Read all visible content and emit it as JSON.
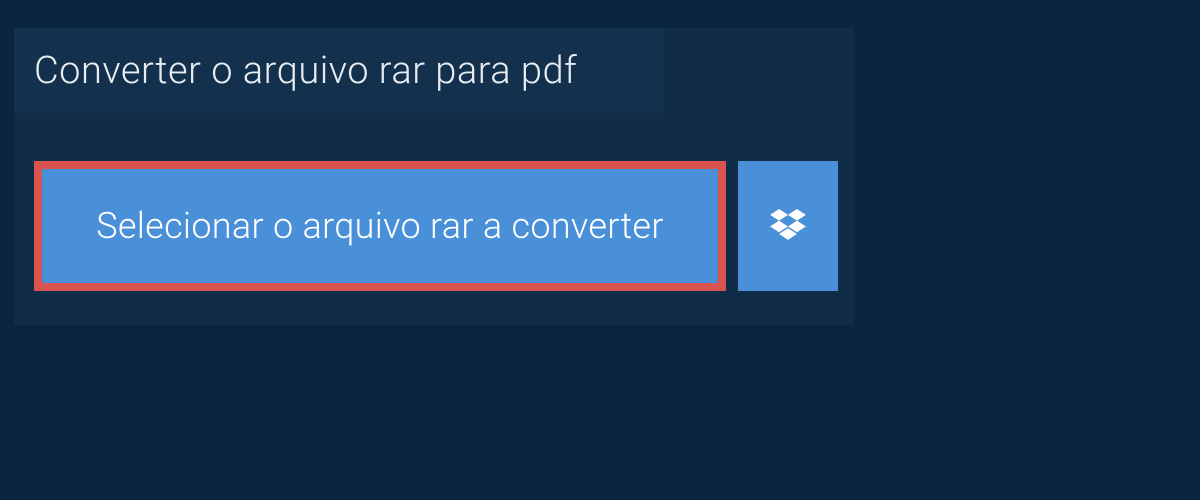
{
  "title": "Converter o arquivo rar para pdf",
  "select_button_label": "Selecionar o arquivo rar a converter",
  "colors": {
    "page_bg": "#0a2540",
    "panel_bg": "#102c47",
    "title_bg": "#13304d",
    "button_bg": "#4a90d9",
    "highlight_border": "#d9534f",
    "text_light": "#e8edf2",
    "text_white": "#ffffff"
  },
  "icons": {
    "dropbox": "dropbox-icon"
  }
}
